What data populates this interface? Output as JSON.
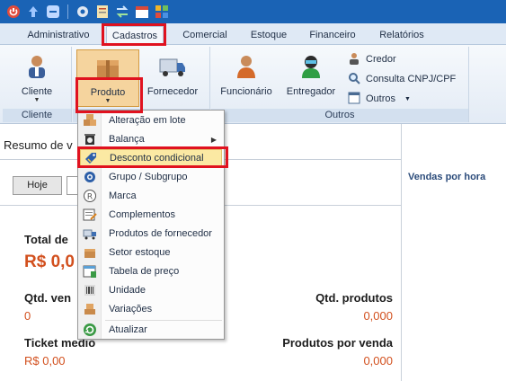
{
  "tabs": [
    "Administrativo",
    "Cadastros",
    "Comercial",
    "Estoque",
    "Financeiro",
    "Relatórios"
  ],
  "ribbon": {
    "cliente": "Cliente",
    "produto": "Produto",
    "fornecedor": "Fornecedor",
    "funcionario": "Funcionário",
    "entregador": "Entregador",
    "credor": "Credor",
    "consulta": "Consulta CNPJ/CPF",
    "outros": "Outros",
    "group_cliente": "Cliente",
    "group_outros": "Outros"
  },
  "page": {
    "title": "Resumo de v",
    "btn_hoje": "Hoje",
    "vendas_hora": "Vendas por hora",
    "total_label": "Total de",
    "total_value": "R$ 0,0",
    "qtd_vendas_label": "Qtd. ven",
    "qtd_vendas_value": "0",
    "qtd_produtos_label": "Qtd. produtos",
    "qtd_produtos_value": "0,000",
    "ticket_label": "Ticket medio",
    "ticket_value": "R$ 0,00",
    "produtos_venda_label": "Produtos por venda",
    "produtos_venda_value": "0,000"
  },
  "menu": {
    "items": [
      "Alteração em lote",
      "Balança",
      "Desconto condicional",
      "Grupo / Subgrupo",
      "Marca",
      "Complementos",
      "Produtos de fornecedor",
      "Setor estoque",
      "Tabela de preço",
      "Unidade",
      "Variações",
      "Atualizar"
    ]
  },
  "colors": {
    "accent": "#1a63b5",
    "highlight": "#fbe9a3",
    "value": "#d2501e",
    "callout": "#e0121f"
  }
}
